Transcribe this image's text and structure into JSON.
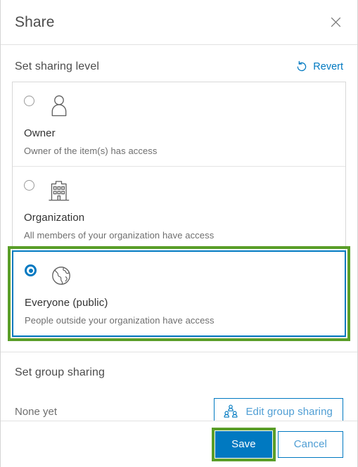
{
  "dialog": {
    "title": "Share",
    "close_icon": "close-icon"
  },
  "sharing_level": {
    "heading": "Set sharing level",
    "revert_label": "Revert",
    "revert_icon": "revert-circular-arrow-icon",
    "options": [
      {
        "id": "owner",
        "label": "Owner",
        "description": "Owner of the item(s) has access",
        "icon": "person-icon",
        "selected": false,
        "highlighted": false
      },
      {
        "id": "organization",
        "label": "Organization",
        "description": "All members of your organization have access",
        "icon": "building-icon",
        "selected": false,
        "highlighted": false
      },
      {
        "id": "everyone",
        "label": "Everyone (public)",
        "description": "People outside your organization have access",
        "icon": "globe-icon",
        "selected": true,
        "highlighted": true
      }
    ]
  },
  "group_sharing": {
    "heading": "Set group sharing",
    "status": "None yet",
    "edit_button_label": "Edit group sharing",
    "edit_button_icon": "group-people-icon"
  },
  "footer": {
    "save_label": "Save",
    "cancel_label": "Cancel",
    "save_highlighted": true
  },
  "colors": {
    "accent_blue": "#0079c1",
    "link_blue": "#4f9ed4",
    "highlight_green": "#5a9e28",
    "text_primary": "#323232",
    "text_secondary": "#6e6e6e",
    "border": "#d8d8d8"
  }
}
